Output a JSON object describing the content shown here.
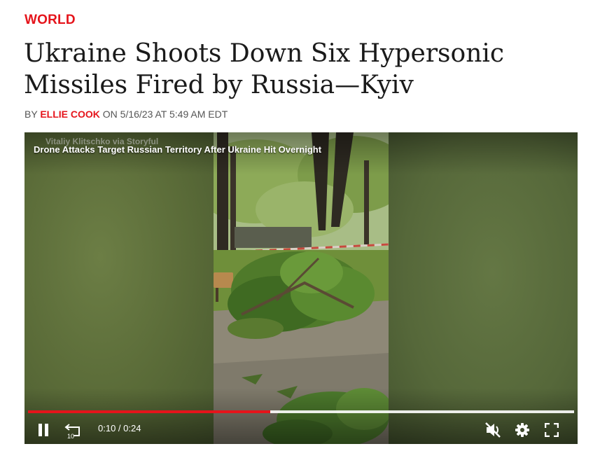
{
  "article": {
    "category": "WORLD",
    "headline": "Ukraine Shoots Down Six Hypersonic Missiles Fired by Russia—Kyiv",
    "byline": {
      "prefix": "BY",
      "author": "ELLIE COOK",
      "date_text": "ON 5/16/23 AT 5:49 AM EDT"
    }
  },
  "video": {
    "watermark": "Vitaliy Klitschko via Storyful",
    "title": "Drone Attacks Target Russian Territory After Ukraine Hit Overnight",
    "progress_fraction": 0.444,
    "current_time": "0:10",
    "duration": "0:24",
    "time_display": "0:10 / 0:24",
    "replay_seconds": "10",
    "state": "playing",
    "muted": true
  },
  "colors": {
    "accent": "#e5141b",
    "headline": "#1a1a1a",
    "byline": "#555555"
  },
  "icons": {
    "pause": "pause-icon",
    "replay": "replay-10-icon",
    "mute": "muted-speaker-icon",
    "settings": "gear-icon",
    "fullscreen": "fullscreen-icon"
  }
}
